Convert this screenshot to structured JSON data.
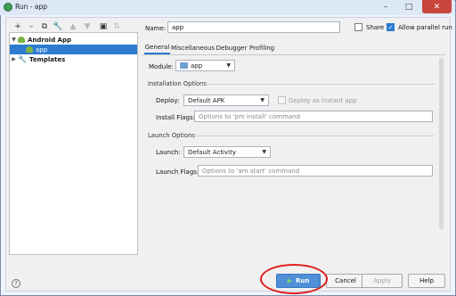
{
  "window": {
    "title": "Run - app",
    "minimize": "–",
    "maximize": "□",
    "close": "✕"
  },
  "toolbar": {
    "add": "+",
    "remove": "–",
    "copy": "⧉",
    "edit": "🔧",
    "move_up": "▲",
    "move_down": "▼",
    "folder": "▣",
    "sort": "⇅"
  },
  "tree": {
    "items": [
      {
        "label": "Android App",
        "expanded": true,
        "bold": true
      },
      {
        "label": "app",
        "selected": true
      },
      {
        "label": "Templates",
        "expanded": false,
        "bold": true
      }
    ]
  },
  "header": {
    "name_label": "Name:",
    "name_value": "app",
    "share_label": "Share",
    "share_checked": false,
    "parallel_label": "Allow parallel run",
    "parallel_checked": true
  },
  "tabs": [
    {
      "label": "General",
      "active": true
    },
    {
      "label": "Miscellaneous"
    },
    {
      "label": "Debugger"
    },
    {
      "label": "Profiling"
    }
  ],
  "general": {
    "module_label": "Module:",
    "module_value": "app",
    "installation_title": "Installation Options",
    "deploy_label": "Deploy:",
    "deploy_value": "Default APK",
    "instant_label": "Deploy as instant app",
    "install_flags_label": "Install Flags:",
    "install_flags_placeholder": "Options to 'pm install' command",
    "launch_title": "Launch Options",
    "launch_label": "Launch:",
    "launch_value": "Default Activity",
    "launch_flags_label": "Launch Flags:",
    "launch_flags_placeholder": "Options to 'am start' command"
  },
  "buttons": {
    "run": "Run",
    "cancel": "Cancel",
    "apply": "Apply",
    "help": "Help",
    "help_icon": "?"
  },
  "colors": {
    "accent": "#2d7bd0",
    "highlight": "#e01b1b",
    "run_button": "#4f8fd8"
  }
}
